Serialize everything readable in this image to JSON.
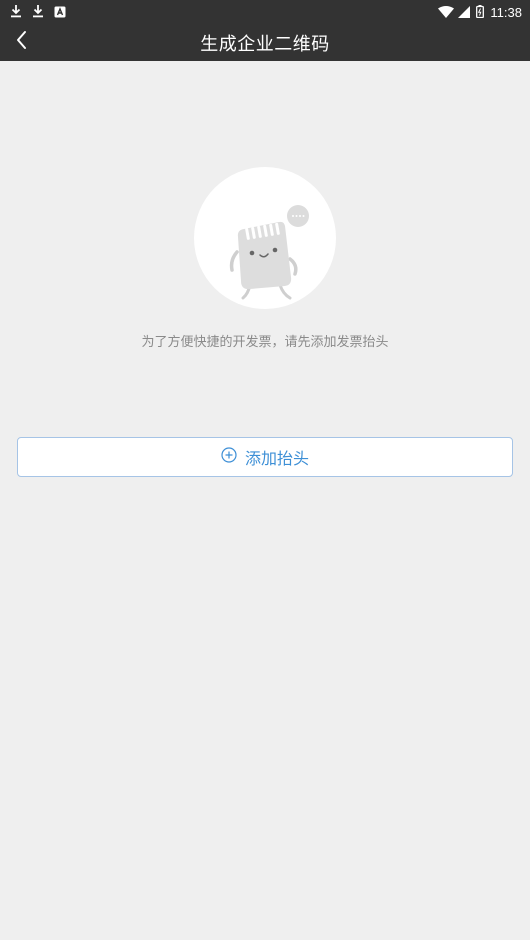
{
  "status_bar": {
    "time": "11:38",
    "icons": [
      "download-icon",
      "download-icon",
      "app-notification-icon",
      "wifi-icon",
      "signal-icon",
      "battery-icon"
    ]
  },
  "header": {
    "title": "生成企业二维码",
    "back_icon": "chevron-left-icon"
  },
  "empty_state": {
    "illustration": "sd-card-mascot-icon",
    "message": "为了方便快捷的开发票，请先添加发票抬头"
  },
  "actions": {
    "add_header_label": "添加抬头",
    "add_header_icon": "plus-circle-icon"
  },
  "colors": {
    "header_bg": "#333333",
    "page_bg": "#efefef",
    "accent": "#3d8fd6",
    "button_border": "#a6c4e6",
    "hint_text": "#8a8a8a"
  }
}
